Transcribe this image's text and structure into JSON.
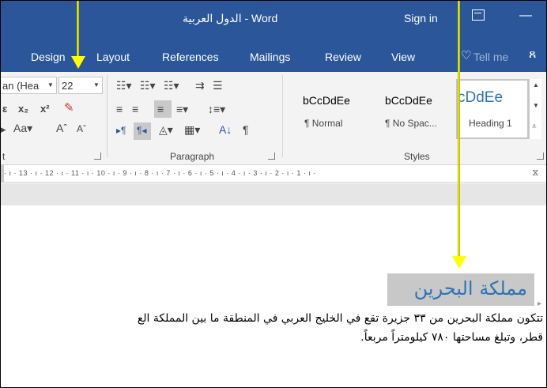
{
  "window": {
    "title": "الدول العربية  -  Word",
    "sign_in": "Sign in"
  },
  "tabs": [
    {
      "label": "Design"
    },
    {
      "label": "Layout"
    },
    {
      "label": "References"
    },
    {
      "label": "Mailings"
    },
    {
      "label": "Review"
    },
    {
      "label": "View"
    },
    {
      "label": "Tell me"
    }
  ],
  "font": {
    "name": "an (Hea",
    "size": "22"
  },
  "groups": {
    "font_label": "t",
    "paragraph_label": "Paragraph",
    "styles_label": "Styles"
  },
  "styles": [
    {
      "preview": "bCcDdEe",
      "name": "¶ Normal"
    },
    {
      "preview": "bCcDdEe",
      "name": "¶ No Spac..."
    },
    {
      "preview": "cDdEe",
      "name": "Heading 1"
    }
  ],
  "ruler": {
    "marks": "· ı · 13 · ı · 12 · ı · 11 · ı · 10 · ı · 9 · ı · 8 · ı · 7 · ı · 6 · ı · 5 · ı · 4 · ı · 3 · ı · 2 · ı · 1 · ı ·"
  },
  "document": {
    "heading": "مملكة البحرين",
    "paragraph_line1": "تتكون مملكة البحرين من ٣٣ جزيرة تقع في الخليج العربي في المنطقة ما بين المملكة الع",
    "paragraph_line2": "قطر، وتبلغ مساحتها ٧٨٠ كيلومتراً مربعاً."
  },
  "colors": {
    "accent": "#2b579a",
    "heading": "#2e74b5",
    "callout": "#ffff00"
  }
}
